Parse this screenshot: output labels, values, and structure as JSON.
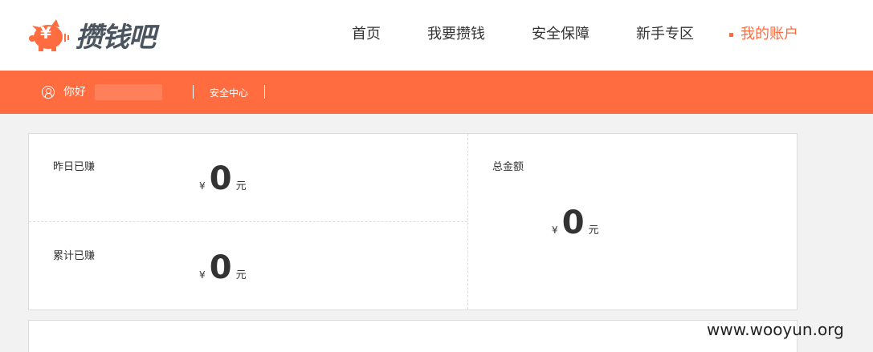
{
  "header": {
    "brand": "攒钱吧",
    "logo_symbol": "¥",
    "nav": [
      {
        "label": "首页",
        "active": false
      },
      {
        "label": "我要攒钱",
        "active": false
      },
      {
        "label": "安全保障",
        "active": false
      },
      {
        "label": "新手专区",
        "active": false
      },
      {
        "label": "我的账户",
        "active": true
      }
    ]
  },
  "subbar": {
    "greeting": "你好",
    "security_center": "安全中心"
  },
  "stats": {
    "yesterday": {
      "label": "昨日已赚",
      "currency": "¥",
      "value": "0",
      "unit": "元"
    },
    "cumulative": {
      "label": "累计已赚",
      "currency": "¥",
      "value": "0",
      "unit": "元"
    },
    "total": {
      "label": "总金额",
      "currency": "¥",
      "value": "0",
      "unit": "元"
    }
  },
  "watermark": "www.wooyun.org",
  "colors": {
    "accent": "#ff6c40",
    "brand_text": "#4a5560"
  }
}
